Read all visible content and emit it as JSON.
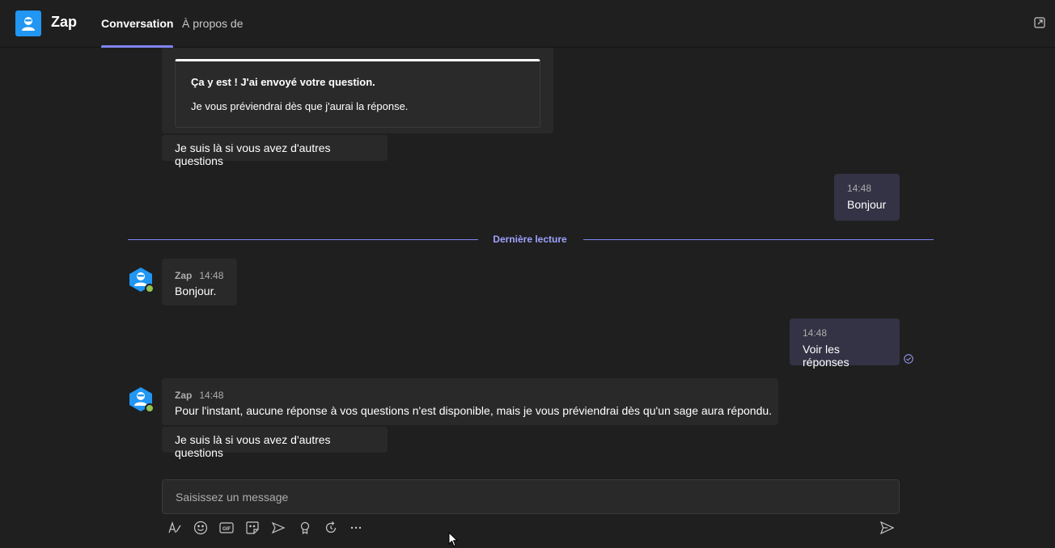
{
  "header": {
    "app_title": "Zap",
    "tabs": [
      {
        "label": "Conversation",
        "active": true
      },
      {
        "label": "À propos de",
        "active": false
      }
    ]
  },
  "messages": {
    "card": {
      "title": "Ça y est ! J'ai envoyé votre question.",
      "text": "Je vous préviendrai dès que j'aurai la réponse."
    },
    "bot_followup_1": "Je suis là si vous avez d'autres questions",
    "user_1": {
      "time": "14:48",
      "text": "Bonjour"
    },
    "divider": "Dernière lecture",
    "bot_1": {
      "name": "Zap",
      "time": "14:48",
      "text": "Bonjour."
    },
    "user_2": {
      "time": "14:48",
      "text": "Voir les réponses"
    },
    "bot_2": {
      "name": "Zap",
      "time": "14:48",
      "text": "Pour l'instant, aucune réponse à vos questions n'est disponible, mais je vous préviendrai dès qu'un sage aura répondu."
    },
    "bot_followup_2": "Je suis là si vous avez d'autres questions"
  },
  "compose": {
    "placeholder": "Saisissez un message"
  },
  "colors": {
    "background": "#1f1f1f",
    "bubble_in": "#292929",
    "bubble_out": "#333345",
    "accent": "#7f85f5",
    "app_icon": "#2196f3",
    "status_available": "#92c353"
  }
}
